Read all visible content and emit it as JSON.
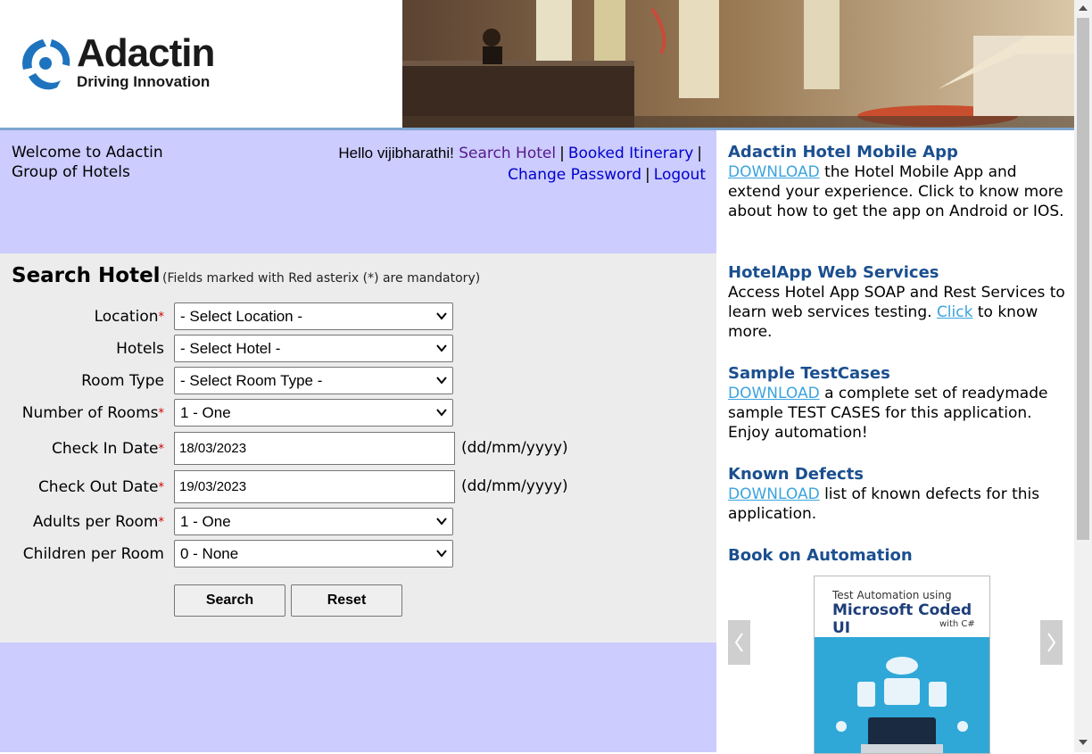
{
  "header": {
    "logo_title": "Adactin",
    "logo_tagline": "Driving Innovation"
  },
  "welcome": {
    "text": "Welcome to Adactin Group of Hotels",
    "hello": "Hello vijibharathi!",
    "links": {
      "search_hotel": "Search Hotel",
      "booked_itinerary": "Booked Itinerary",
      "change_password": "Change Password",
      "logout": "Logout"
    },
    "separator": "|"
  },
  "search": {
    "title": "Search Hotel",
    "note": "(Fields marked with Red asterix (*) are mandatory)",
    "required_marker": "*",
    "fields": {
      "location": {
        "label": "Location",
        "value": "- Select Location -"
      },
      "hotels": {
        "label": "Hotels",
        "value": "- Select Hotel -"
      },
      "room_type": {
        "label": "Room Type",
        "value": "- Select Room Type -"
      },
      "rooms": {
        "label": "Number of Rooms",
        "value": "1 - One"
      },
      "check_in": {
        "label": "Check In Date",
        "value": "18/03/2023",
        "hint": "(dd/mm/yyyy)"
      },
      "check_out": {
        "label": "Check Out Date",
        "value": "19/03/2023",
        "hint": "(dd/mm/yyyy)"
      },
      "adults": {
        "label": "Adults per Room",
        "value": "1 - One"
      },
      "children": {
        "label": "Children per Room",
        "value": "0 - None"
      }
    },
    "buttons": {
      "search": "Search",
      "reset": "Reset"
    }
  },
  "sidebar": {
    "mobile_app": {
      "title": "Adactin Hotel Mobile App",
      "link": "DOWNLOAD",
      "text": "the Hotel Mobile App and extend your experience. Click to know more about how to get the app on Android or IOS."
    },
    "web_services": {
      "title": "HotelApp Web Services",
      "text_before": "Access Hotel App SOAP and Rest Services to learn web services testing.",
      "link": "Click",
      "text_after": "to know more."
    },
    "test_cases": {
      "title": "Sample TestCases",
      "link": "DOWNLOAD",
      "text": "a complete set of readymade sample TEST CASES for this application. Enjoy automation!"
    },
    "known_defects": {
      "title": "Known Defects",
      "link": "DOWNLOAD",
      "text": "list of known defects for this application."
    },
    "book": {
      "title": "Book on Automation",
      "cover_line1": "Test Automation using",
      "cover_line2": "Microsoft Coded UI",
      "cover_line3": "with C#"
    }
  },
  "colors": {
    "welcome_bg": "#ccccff",
    "form_bg": "#ececec",
    "link": "#0000cc",
    "sidebar_heading": "#1b4f8f",
    "sidebar_link": "#3ba3dd",
    "required": "#cc0000"
  },
  "icons": {
    "logo": "adactin-logo-icon",
    "select_arrow": "chevron-down-icon",
    "carousel_prev": "chevron-left-icon",
    "carousel_next": "chevron-right-icon"
  }
}
